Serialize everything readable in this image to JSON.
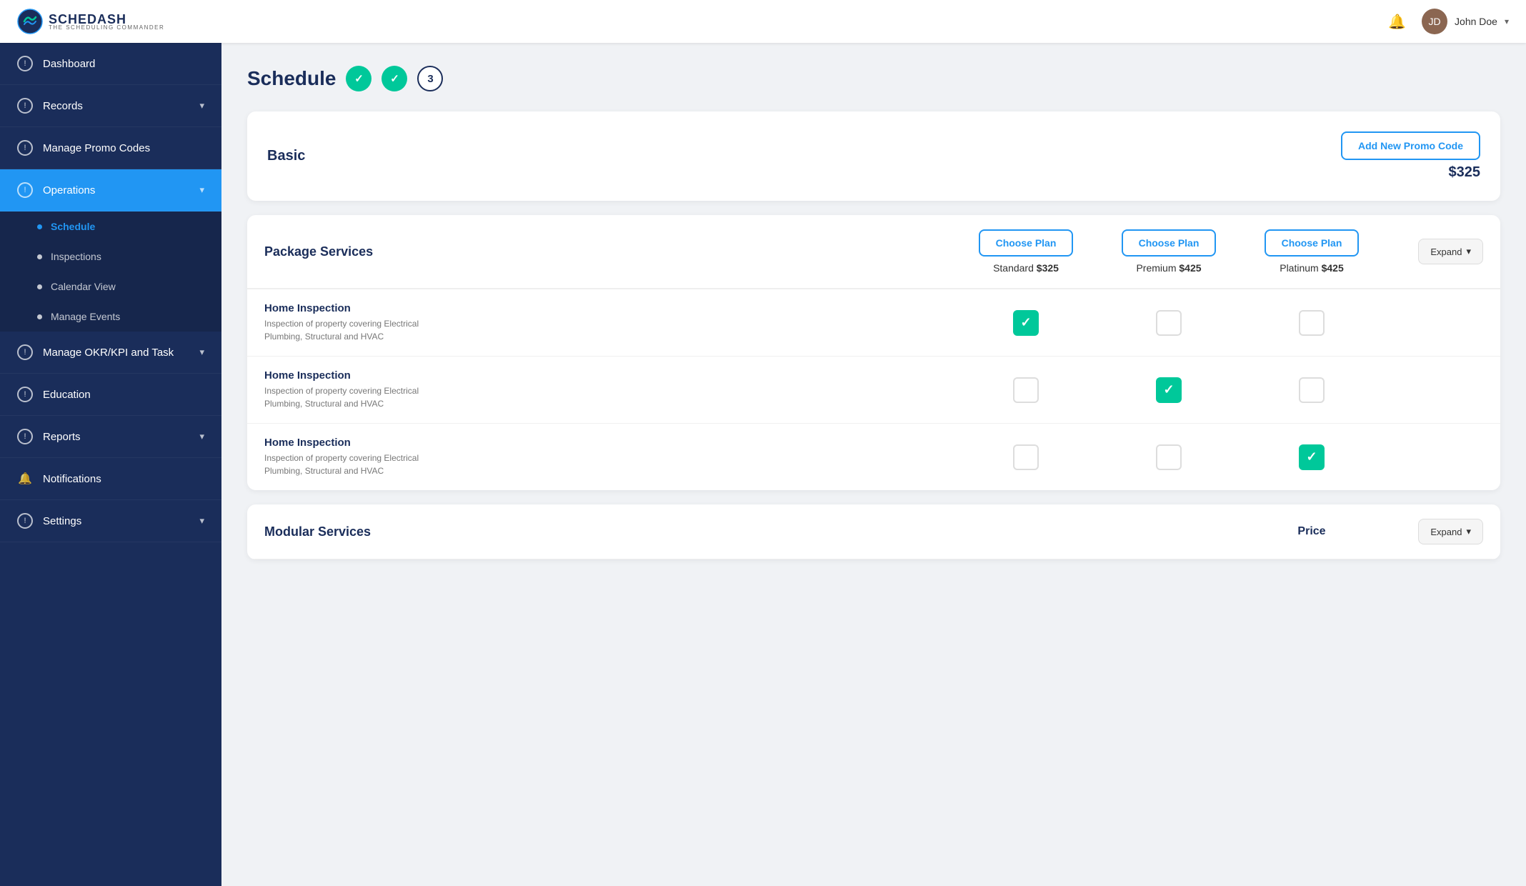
{
  "app": {
    "name": "SCHEDASH",
    "tagline": "THE SCHEDULING COMMANDER"
  },
  "header": {
    "bell_label": "notifications",
    "user_name": "John Doe",
    "chevron": "▾"
  },
  "sidebar": {
    "items": [
      {
        "id": "dashboard",
        "label": "Dashboard",
        "icon": "!",
        "hasChevron": false,
        "active": false
      },
      {
        "id": "records",
        "label": "Records",
        "icon": "!",
        "hasChevron": true,
        "active": false
      },
      {
        "id": "manage-promo",
        "label": "Manage Promo Codes",
        "icon": "!",
        "hasChevron": false,
        "active": false
      },
      {
        "id": "operations",
        "label": "Operations",
        "icon": "!",
        "hasChevron": true,
        "active": true
      },
      {
        "id": "manage-okr",
        "label": "Manage OKR/KPI and Task",
        "icon": "!",
        "hasChevron": true,
        "active": false
      },
      {
        "id": "education",
        "label": "Education",
        "icon": "!",
        "hasChevron": false,
        "active": false
      },
      {
        "id": "reports",
        "label": "Reports",
        "icon": "!",
        "hasChevron": true,
        "active": false
      },
      {
        "id": "notifications",
        "label": "Notifications",
        "icon": "bell",
        "hasChevron": false,
        "active": false
      },
      {
        "id": "settings",
        "label": "Settings",
        "icon": "!",
        "hasChevron": true,
        "active": false
      }
    ],
    "submenu": [
      {
        "id": "schedule",
        "label": "Schedule",
        "active": true
      },
      {
        "id": "inspections",
        "label": "Inspections",
        "active": false
      },
      {
        "id": "calendar-view",
        "label": "Calendar View",
        "active": false
      },
      {
        "id": "manage-events",
        "label": "Manage Events",
        "active": false
      }
    ]
  },
  "page": {
    "title": "Schedule",
    "steps": [
      {
        "id": 1,
        "done": true
      },
      {
        "id": 2,
        "done": true
      },
      {
        "id": 3,
        "done": false,
        "label": "3"
      }
    ]
  },
  "promo_section": {
    "label": "Basic",
    "add_promo_btn": "Add New Promo Code",
    "price": "$325"
  },
  "package_services": {
    "title": "Package Services",
    "expand_btn": "Expand",
    "plans": [
      {
        "id": "standard",
        "btn_label": "Choose Plan",
        "name": "Standard",
        "price": "$325"
      },
      {
        "id": "premium",
        "btn_label": "Choose Plan",
        "name": "Premium",
        "price": "$425"
      },
      {
        "id": "platinum",
        "btn_label": "Choose Plan",
        "name": "Platinum",
        "price": "$425"
      }
    ],
    "rows": [
      {
        "name": "Home Inspection",
        "desc": "Inspection of property covering Electrical Plumbing, Structural and HVAC",
        "standard": true,
        "premium": false,
        "platinum": false
      },
      {
        "name": "Home Inspection",
        "desc": "Inspection of property covering Electrical Plumbing, Structural and HVAC",
        "standard": false,
        "premium": true,
        "platinum": false
      },
      {
        "name": "Home Inspection",
        "desc": "Inspection of property covering Electrical Plumbing, Structural and HVAC",
        "standard": false,
        "premium": false,
        "platinum": true
      }
    ]
  },
  "modular_services": {
    "title": "Modular Services",
    "price_col": "Price",
    "expand_btn": "Expand"
  }
}
